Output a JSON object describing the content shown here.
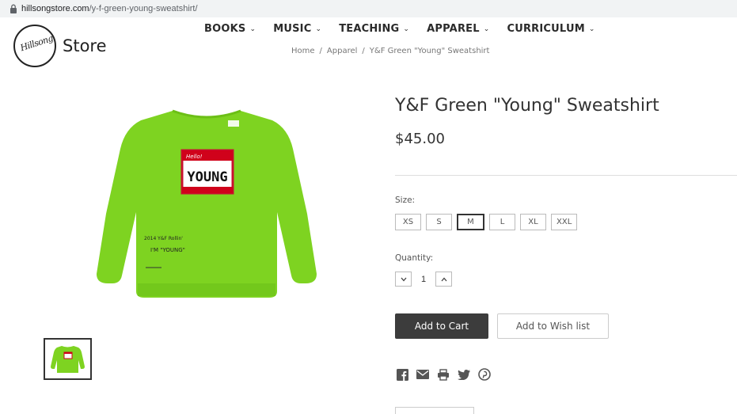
{
  "browser": {
    "url_host": "hillsongstore.com",
    "url_path": "/y-f-green-young-sweatshirt/"
  },
  "logo": {
    "script_text": "Hillsong",
    "store_label": "Store"
  },
  "nav": {
    "items": [
      {
        "label": "BOOKS"
      },
      {
        "label": "MUSIC"
      },
      {
        "label": "TEACHING"
      },
      {
        "label": "APPAREL"
      },
      {
        "label": "CURRICULUM"
      }
    ]
  },
  "breadcrumb": {
    "items": [
      "Home",
      "Apparel",
      "Y&F Green \"Young\" Sweatshirt"
    ],
    "separator": "/"
  },
  "product": {
    "title": "Y&F Green \"Young\" Sweatshirt",
    "price": "$45.00",
    "image_color": "#7ed321",
    "shirt_print": {
      "tag_top": "Hello!",
      "tag_word": "YOUNG",
      "sleeve_lines": [
        "2014  Y&F Rollin'",
        "I'M \"YOUNG\""
      ]
    }
  },
  "options": {
    "size_label": "Size:",
    "sizes": [
      "XS",
      "S",
      "M",
      "L",
      "XL",
      "XXL"
    ],
    "selected_size": "M",
    "quantity_label": "Quantity:",
    "quantity": "1"
  },
  "actions": {
    "add_to_cart": "Add to Cart",
    "add_to_wishlist": "Add to Wish list"
  },
  "share_icons": [
    "facebook-icon",
    "email-icon",
    "print-icon",
    "twitter-icon",
    "pinterest-icon"
  ]
}
